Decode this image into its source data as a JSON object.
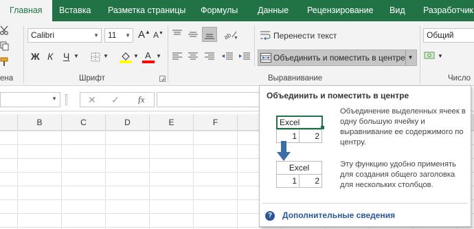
{
  "tabs": [
    {
      "label": "Главная",
      "active": true
    },
    {
      "label": "Вставка"
    },
    {
      "label": "Разметка страницы"
    },
    {
      "label": "Формулы"
    },
    {
      "label": "Данные"
    },
    {
      "label": "Рецензирование"
    },
    {
      "label": "Вид"
    },
    {
      "label": "Разработчик"
    }
  ],
  "ribbon": {
    "clipboard_label": "ена",
    "font": {
      "group_label": "Шрифт",
      "font_name": "Calibri",
      "font_size": "11",
      "grow": "A",
      "shrink": "A",
      "bold": "Ж",
      "italic": "К",
      "underline": "Ч",
      "font_color_letter": "A",
      "highlight_color": "#ffff00",
      "font_color": "#ff0000"
    },
    "alignment": {
      "group_label": "Выравнивание",
      "wrap_text": "Перенести текст",
      "merge_center": "Объединить и поместить в центре"
    },
    "number": {
      "group_label": "Число",
      "format": "Общий"
    }
  },
  "formula_bar": {
    "cancel": "✕",
    "enter": "✓",
    "fx": "fx"
  },
  "columns": [
    "B",
    "C",
    "D",
    "E",
    "F"
  ],
  "tooltip": {
    "title": "Объединить и поместить в центре",
    "description": "Объединение выделенных ячеек в одну большую ячейку и выравнивание ее содержимого по центру.",
    "hint": "Эту функцию удобно применять для создания общего заголовка для нескольких столбцов.",
    "illustration": {
      "top_label": "Excel",
      "top_values": [
        "1",
        "2"
      ],
      "bottom_label": "Excel",
      "bottom_values": [
        "1",
        "2"
      ]
    },
    "more_info": "Дополнительные сведения"
  },
  "colors": {
    "accent": "#217346",
    "link": "#2b579a"
  }
}
